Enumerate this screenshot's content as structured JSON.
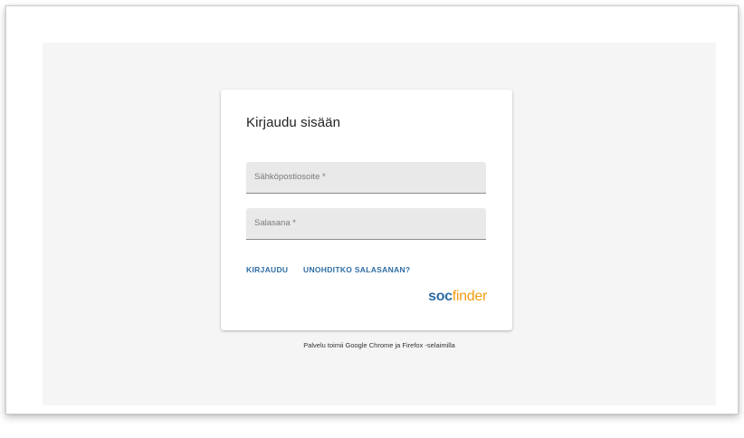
{
  "login": {
    "title": "Kirjaudu sisään",
    "email_label": "Sähköpostiosoite *",
    "password_label": "Salasana *",
    "login_button": "KIRJAUDU",
    "forgot_button": "UNOHDITKO SALASANAN?",
    "logo_soc": "soc",
    "logo_finder": "finder"
  },
  "footer": {
    "browser_note": "Palvelu toimii Google Chrome ja Firefox -selaimilla"
  },
  "colors": {
    "accent": "#2e6da4",
    "logo_orange": "#f39c12",
    "background": "#f5f5f5",
    "field_fill": "#e9e9e9"
  }
}
